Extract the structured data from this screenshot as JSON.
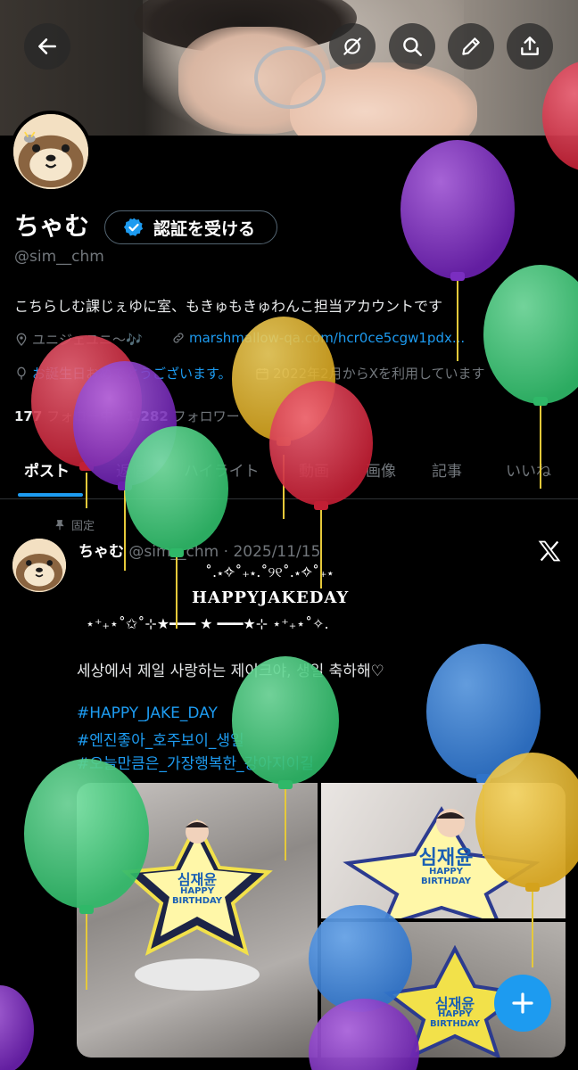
{
  "header": {
    "back_icon": "arrow-left-icon",
    "actions": [
      "hide-icon",
      "search-icon",
      "pencil-icon",
      "share-icon"
    ]
  },
  "profile": {
    "name": "ちゃむ",
    "verify_label": "認証を受ける",
    "handle": "@sim__chm",
    "bio": "こちらしむ課じぇゆに室、もきゅもきゅわんこ担当アカウントです",
    "location": "ユニジェユニ〜🎶",
    "link": "marshmallow-qa.com/hcr0ce5cgw1pdx...",
    "birthday": "お誕生日おめでとうございます。",
    "joined": "2022年2月からXを利用しています",
    "following_count": "177",
    "following_label": "フォロー中",
    "followers_count": "1,282",
    "followers_label": "フォロワー"
  },
  "tabs": [
    "ポスト",
    "返信",
    "ハイライト",
    "動画",
    "画像",
    "記事",
    "いいね"
  ],
  "post": {
    "pinned_label": "固定",
    "author": "ちゃむ",
    "handle_date": "@sim__chm · 2025/11/15",
    "deco_top": "˚.⋆✧˚₊⋆.˚୨୧˚.⋆✧˚₊⋆",
    "title": "HAPPYJAKEDAY",
    "deco_bottom": "⋆⁺₊⋆˚✩˚⊹★━━━ ★ ━━━★⊹ ⋆⁺₊⋆˚✧.",
    "text": "세상에서 제일 사랑하는 제이크야, 생일 축하해♡",
    "hashtags": [
      "#HAPPY_JAKE_DAY",
      "#엔진좋아_호주보이_생일",
      "#오늘만큼은_가장행복한_강아지이길"
    ],
    "cake_name": "심재윤",
    "cake_happy": "HAPPY",
    "cake_birthday": "BIRTHDAY"
  },
  "colors": {
    "accent": "#1d9bf0",
    "balloon_purple": "#7b2fbe",
    "balloon_green": "#3fc97a",
    "balloon_red": "#d92b40",
    "balloon_yellow": "#e3b52c",
    "balloon_blue": "#3a82d8"
  }
}
